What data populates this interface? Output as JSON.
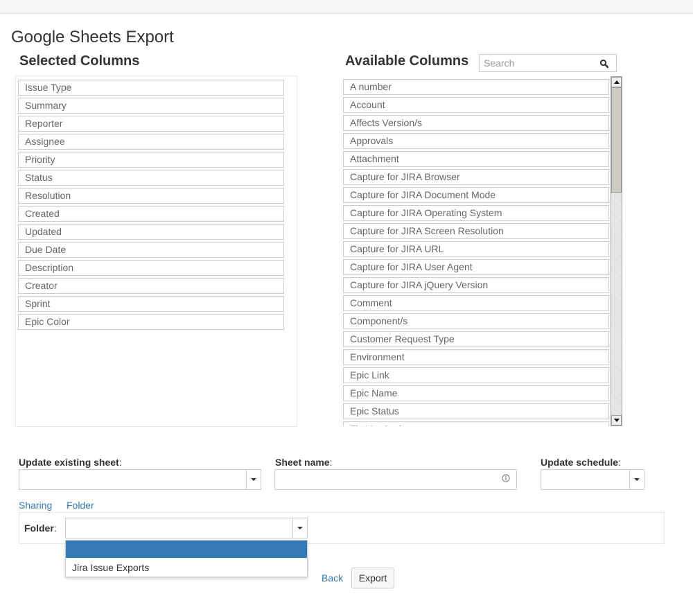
{
  "page": {
    "title": "Google Sheets Export"
  },
  "selected": {
    "heading": "Selected Columns",
    "items": [
      "Issue Type",
      "Summary",
      "Reporter",
      "Assignee",
      "Priority",
      "Status",
      "Resolution",
      "Created",
      "Updated",
      "Due Date",
      "Description",
      "Creator",
      "Sprint",
      "Epic Color"
    ]
  },
  "available": {
    "heading": "Available Columns",
    "search_placeholder": "Search",
    "items": [
      "A number",
      "Account",
      "Affects Version/s",
      "Approvals",
      "Attachment",
      "Capture for JIRA Browser",
      "Capture for JIRA Document Mode",
      "Capture for JIRA Operating System",
      "Capture for JIRA Screen Resolution",
      "Capture for JIRA URL",
      "Capture for JIRA User Agent",
      "Capture for JIRA jQuery Version",
      "Comment",
      "Component/s",
      "Customer Request Type",
      "Environment",
      "Epic Link",
      "Epic Name",
      "Epic Status",
      "Fix Version/s"
    ]
  },
  "form": {
    "update_existing_label": "Update existing sheet",
    "sheet_name_label": "Sheet name",
    "update_schedule_label": "Update schedule",
    "colon": ":"
  },
  "tabs": {
    "sharing": "Sharing",
    "folder": "Folder"
  },
  "folder": {
    "label": "Folder",
    "options": [
      "",
      "Jira Issue Exports"
    ]
  },
  "actions": {
    "back": "Back",
    "export": "Export"
  },
  "colors": {
    "link": "#337ab7",
    "highlight": "#337ab7",
    "border": "#cccccc"
  }
}
